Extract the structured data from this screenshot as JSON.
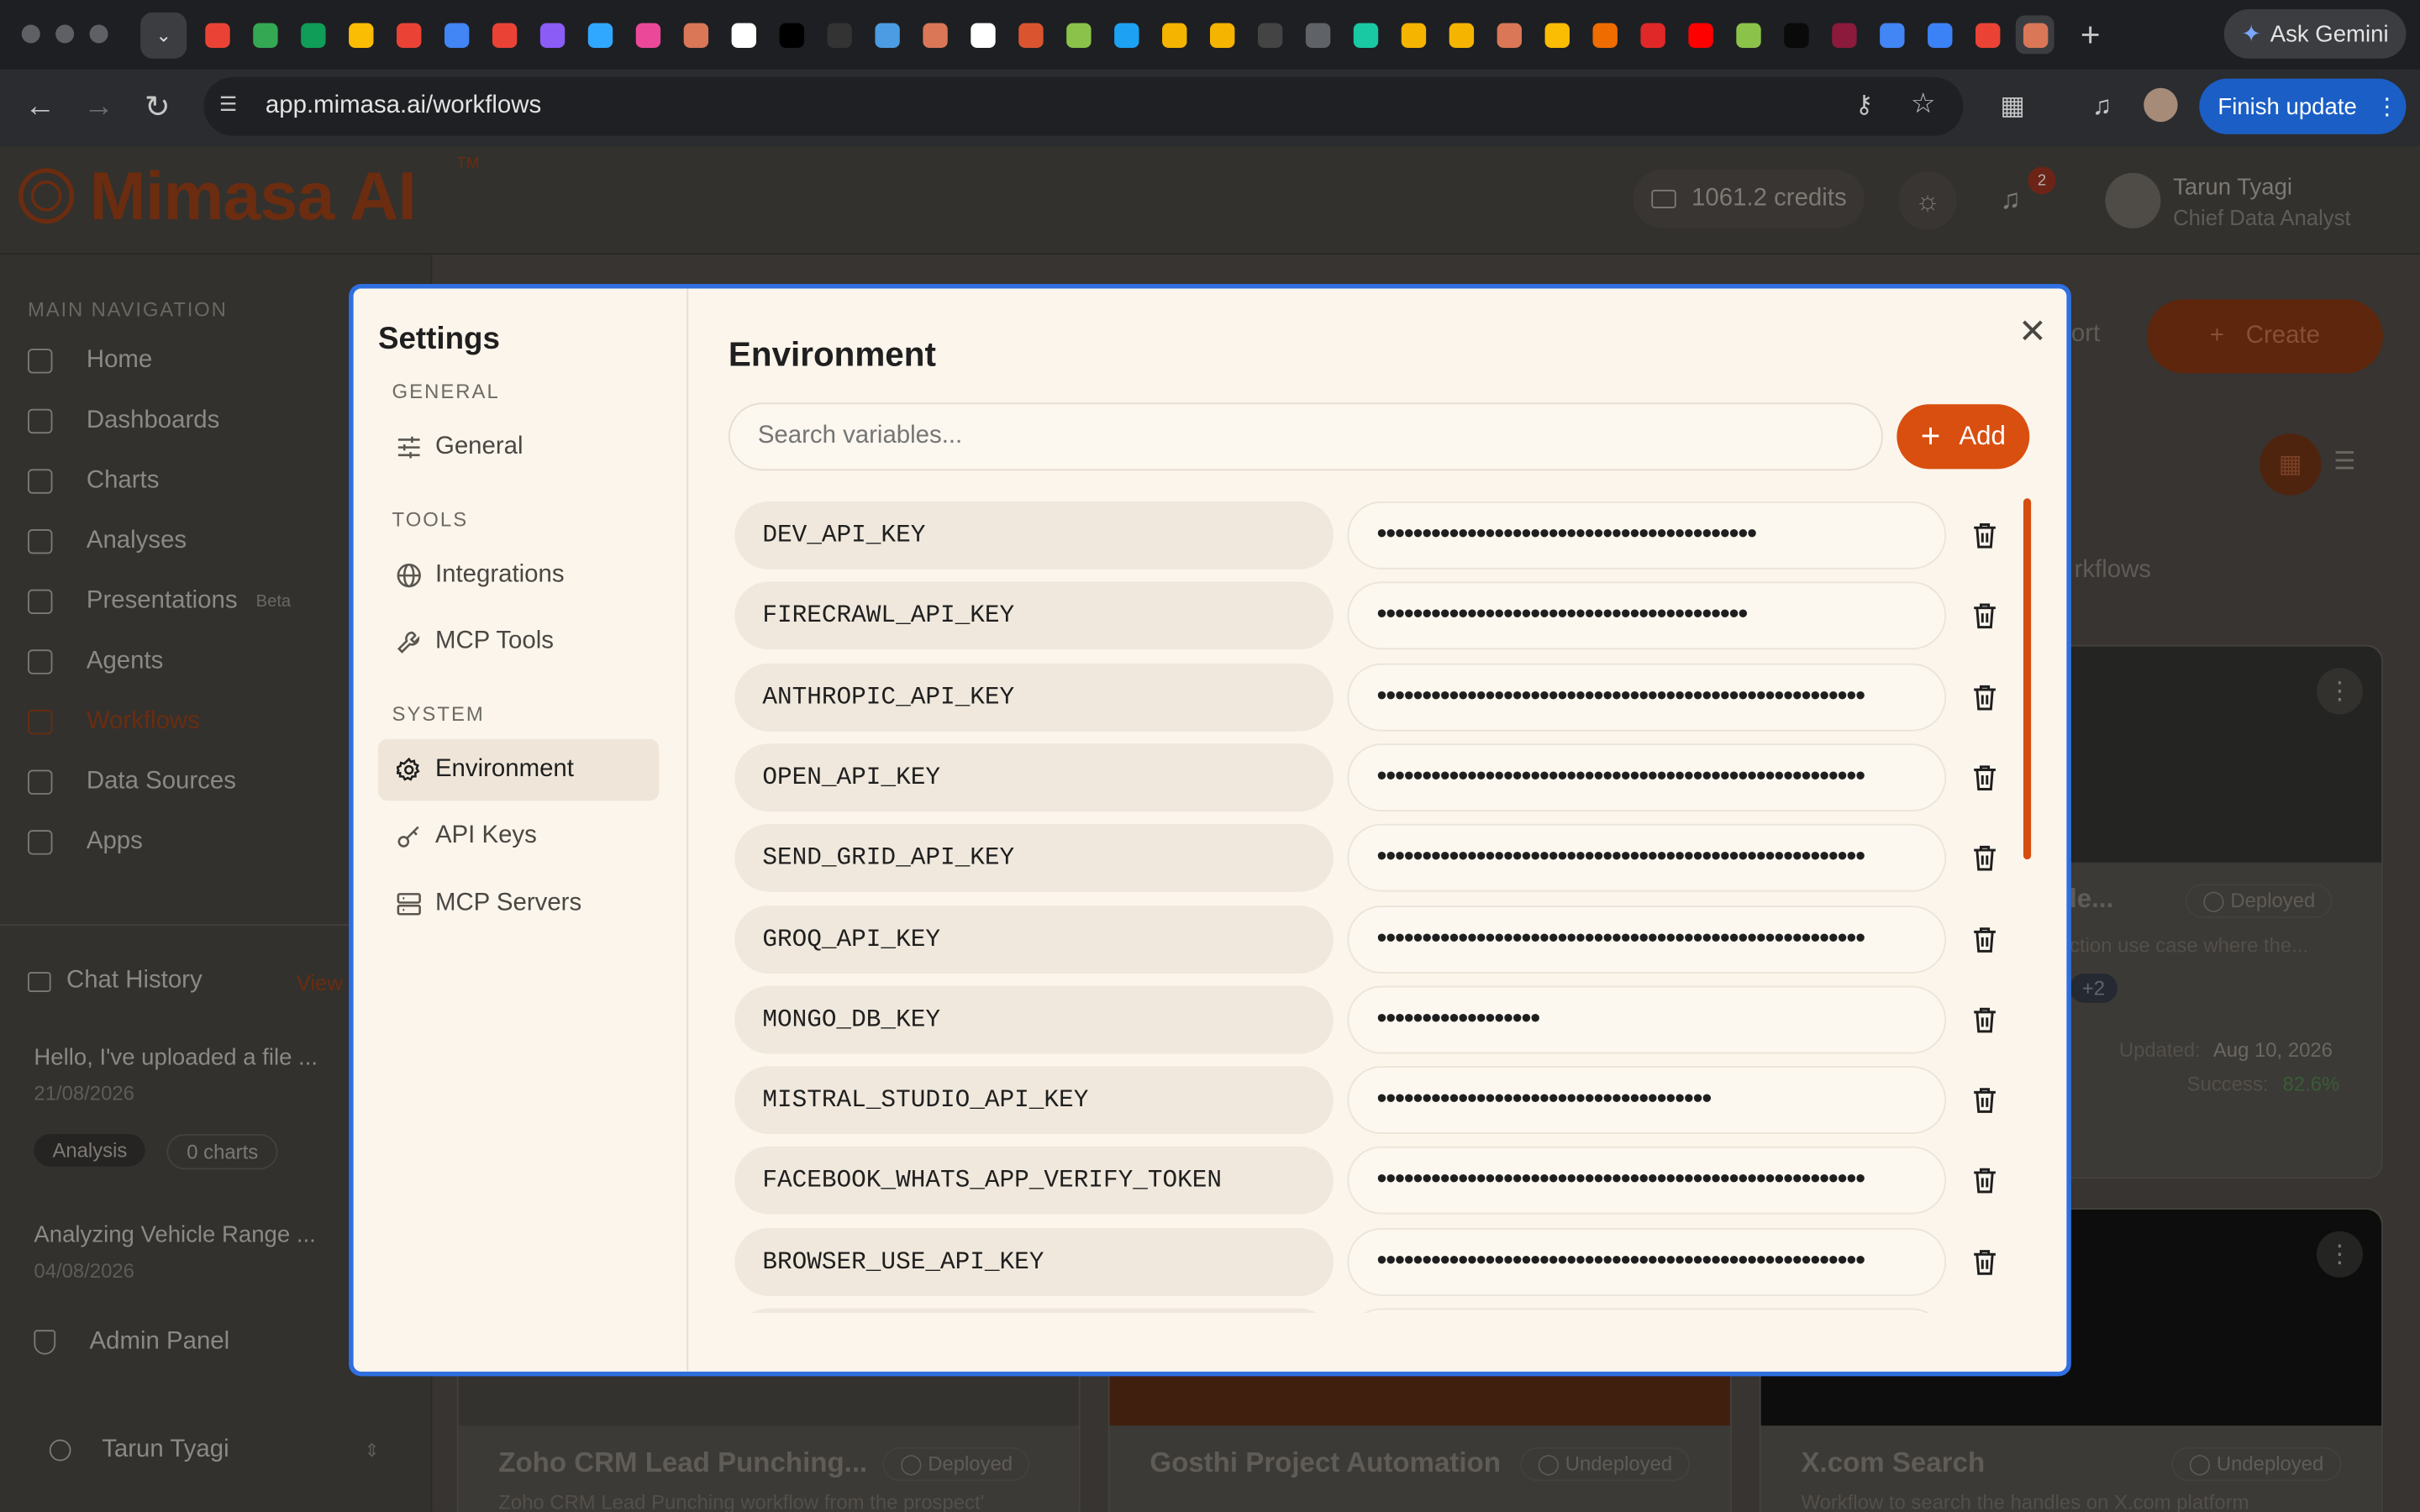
{
  "browser": {
    "url": "app.mimasa.ai/workflows",
    "ask_gemini": "Ask Gemini",
    "finish_update": "Finish update",
    "tab_icons": [
      "gmail-icon",
      "drive-icon",
      "sheets-icon",
      "keep-icon",
      "gmail-icon",
      "calendar-icon",
      "gmail-icon",
      "arc-icon",
      "photoshop-icon",
      "notion-icon",
      "app-icon",
      "chatgpt-icon",
      "medium-icon",
      "app-icon",
      "app-icon",
      "claude-icon",
      "github-icon",
      "producthunt-icon",
      "app-icon",
      "app-icon",
      "app-icon",
      "app-icon",
      "cb-icon",
      "app-icon",
      "app-icon",
      "app-icon",
      "app-icon",
      "app-icon",
      "chart-icon",
      "app-icon",
      "flipboard-icon",
      "youtube-icon",
      "app-icon",
      "dev-icon",
      "app-icon",
      "google-icon",
      "app-icon",
      "app-icon",
      "active-tab-icon"
    ]
  },
  "app": {
    "brand": "Mimasa AI",
    "tm": "TM",
    "credits": "1061.2 credits",
    "notifications": "2",
    "user_name": "Tarun Tyagi",
    "user_role": "Chief Data Analyst",
    "header_right_partial": "ort",
    "create_label": "Create",
    "nav_section": "MAIN NAVIGATION",
    "nav": [
      "Home",
      "Dashboards",
      "Charts",
      "Analyses",
      "Presentations",
      "Agents",
      "Workflows",
      "Data Sources",
      "Apps"
    ],
    "beta": "Beta",
    "chat_history": "Chat History",
    "view": "View",
    "chats": [
      {
        "title": "Hello, I've uploaded a file ...",
        "date": "21/08/2026",
        "tag1": "Analysis",
        "tag2": "0 charts"
      },
      {
        "title": "Analyzing Vehicle Range ...",
        "date": "04/08/2026"
      }
    ],
    "admin_panel": "Admin Panel",
    "footer_user": "Tarun Tyagi",
    "bg_cards": {
      "filter_partial": "rkflows",
      "card1_title_partial": "le...",
      "card1_status": "Deployed",
      "card1_desc_partial": "ction use case where the...",
      "card1_extra": "+2",
      "card1_updated_label": "Updated:",
      "card1_updated": "Aug 10, 2026",
      "card1_success_label": "Success:",
      "card1_success": "82.6%",
      "card2_title": "Zoho CRM Lead Punching...",
      "card2_status": "Deployed",
      "card2_desc": "Zoho CRM Lead Punching workflow from the prospect'",
      "card3_title": "Gosthi Project Automation",
      "card3_status": "Undeployed",
      "card4_title": "X.com Search",
      "card4_status": "Undeployed",
      "card4_desc": "Workflow to search the handles on X.com platform"
    }
  },
  "settings": {
    "title": "Settings",
    "sections": [
      {
        "label": "GENERAL",
        "items": [
          "General"
        ]
      },
      {
        "label": "TOOLS",
        "items": [
          "Integrations",
          "MCP Tools"
        ]
      },
      {
        "label": "SYSTEM",
        "items": [
          "Environment",
          "API Keys",
          "MCP Servers"
        ]
      }
    ],
    "active": "Environment",
    "panel_title": "Environment",
    "search_placeholder": "Search variables...",
    "add_label": "Add",
    "variables": [
      {
        "key": "DEV_API_KEY",
        "value": "••••••••••••••••••••••••••••••••••••••••••"
      },
      {
        "key": "FIRECRAWL_API_KEY",
        "value": "•••••••••••••••••••••••••••••••••••••••••"
      },
      {
        "key": "ANTHROPIC_API_KEY",
        "value": "••••••••••••••••••••••••••••••••••••••••••••••••••••••"
      },
      {
        "key": "OPEN_API_KEY",
        "value": "••••••••••••••••••••••••••••••••••••••••••••••••••••••"
      },
      {
        "key": "SEND_GRID_API_KEY",
        "value": "••••••••••••••••••••••••••••••••••••••••••••••••••••••"
      },
      {
        "key": "GROQ_API_KEY",
        "value": "••••••••••••••••••••••••••••••••••••••••••••••••••••••"
      },
      {
        "key": "MONGO_DB_KEY",
        "value": "••••••••••••••••••"
      },
      {
        "key": "MISTRAL_STUDIO_API_KEY",
        "value": "•••••••••••••••••••••••••••••••••••••"
      },
      {
        "key": "FACEBOOK_WHATS_APP_VERIFY_TOKEN",
        "value": "••••••••••••••••••••••••••••••••••••••••••••••••••••••"
      },
      {
        "key": "BROWSER_USE_API_KEY",
        "value": "••••••••••••••••••••••••••••••••••••••••••••••••••••••"
      }
    ]
  },
  "colors": {
    "accent": "#d94f10",
    "modal_bg": "#fbf5ec",
    "focus": "#2f6fe0"
  }
}
